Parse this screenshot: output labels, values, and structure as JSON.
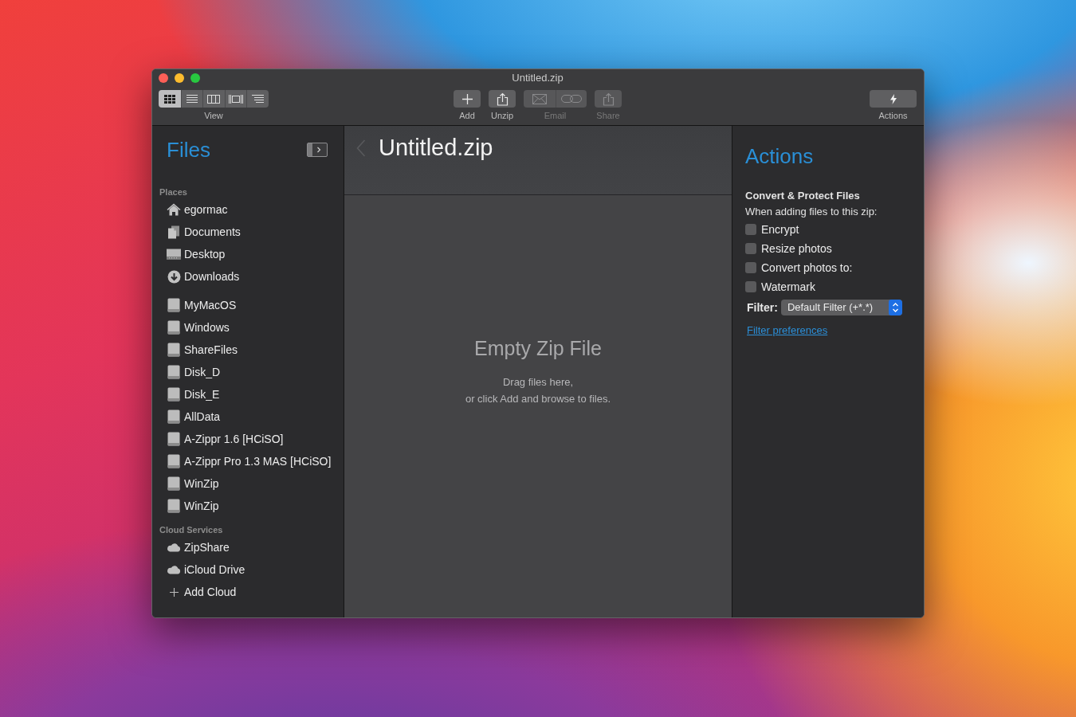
{
  "window": {
    "title": "Untitled.zip"
  },
  "toolbar": {
    "view": {
      "label": "View",
      "modes": [
        {
          "kind": "icons",
          "selected": true
        },
        {
          "kind": "list",
          "selected": false
        },
        {
          "kind": "columns",
          "selected": false
        },
        {
          "kind": "coverflow",
          "selected": false
        },
        {
          "kind": "outline",
          "selected": false
        }
      ]
    },
    "buttons": [
      {
        "kind": "add",
        "label": "Add",
        "disabled": false
      },
      {
        "kind": "unzip",
        "label": "Unzip",
        "disabled": false
      },
      {
        "kind": "email",
        "label": "Email",
        "disabled": true
      },
      {
        "kind": "share",
        "label": "Share",
        "disabled": true
      }
    ],
    "actions": {
      "label": "Actions"
    }
  },
  "sidebar": {
    "title": "Files",
    "sections": [
      {
        "heading": "Places",
        "groups": [
          {
            "items": [
              {
                "kind": "home",
                "label": "egormac"
              },
              {
                "kind": "documents",
                "label": "Documents"
              },
              {
                "kind": "desktop",
                "label": "Desktop"
              },
              {
                "kind": "downloads",
                "label": "Downloads"
              }
            ]
          },
          {
            "items": [
              {
                "kind": "drive",
                "label": "MyMacOS"
              },
              {
                "kind": "drive",
                "label": "Windows"
              },
              {
                "kind": "drive",
                "label": "ShareFiles"
              },
              {
                "kind": "drive",
                "label": "Disk_D"
              },
              {
                "kind": "drive",
                "label": "Disk_E"
              },
              {
                "kind": "drive",
                "label": "AllData"
              },
              {
                "kind": "drive",
                "label": "A-Zippr 1.6 [HCiSO]"
              },
              {
                "kind": "drive",
                "label": "A-Zippr Pro 1.3 MAS [HCiSO]"
              },
              {
                "kind": "drive",
                "label": "WinZip"
              },
              {
                "kind": "drive",
                "label": "WinZip"
              }
            ]
          }
        ]
      },
      {
        "heading": "Cloud Services",
        "groups": [
          {
            "items": [
              {
                "kind": "cloud",
                "label": "ZipShare"
              },
              {
                "kind": "cloud",
                "label": "iCloud Drive"
              },
              {
                "kind": "add",
                "label": "Add Cloud"
              }
            ]
          }
        ]
      }
    ]
  },
  "archive": {
    "back": {
      "disabled": true
    },
    "title": "Untitled.zip",
    "empty_title": "Empty Zip File",
    "hint_lines": [
      "Drag files here,",
      "or click Add and browse to files."
    ]
  },
  "actions_panel": {
    "title": "Actions",
    "heading": "Convert & Protect Files",
    "intro": "When adding files to this zip:",
    "options": [
      {
        "label": "Encrypt",
        "checked": false
      },
      {
        "label": "Resize photos",
        "checked": false
      },
      {
        "label": "Convert photos to:",
        "checked": false
      },
      {
        "label": "Watermark",
        "checked": false
      }
    ],
    "filter": {
      "label": "Filter:",
      "value": "Default Filter (+*.*)"
    },
    "link": "Filter preferences"
  }
}
